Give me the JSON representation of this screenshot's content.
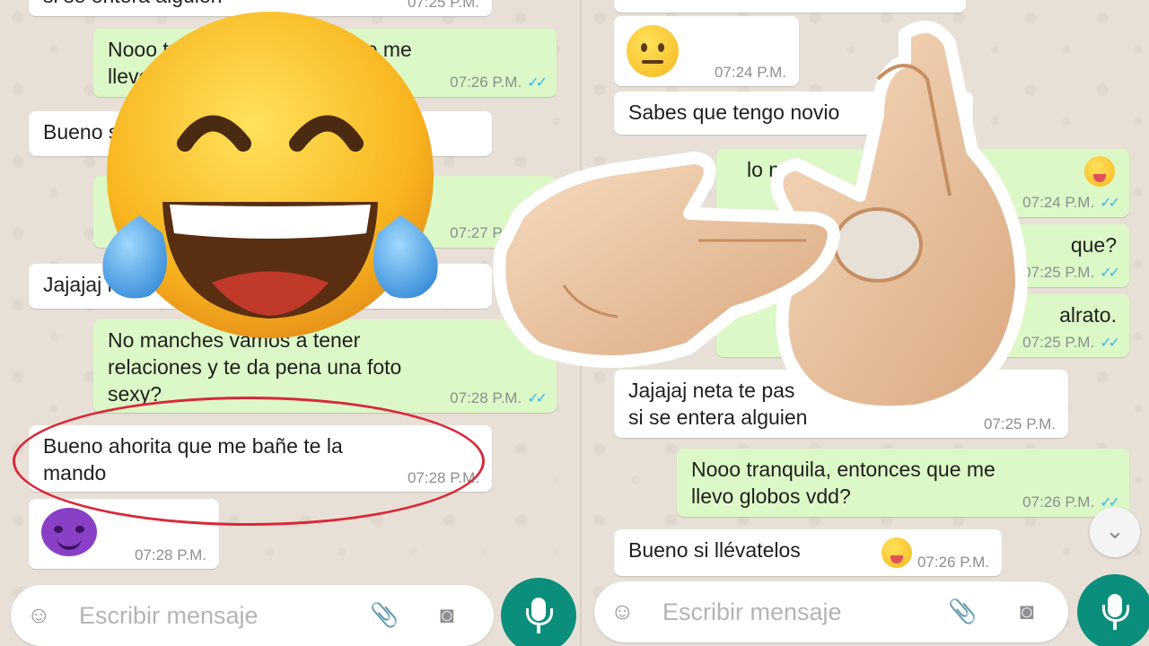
{
  "left": {
    "messages": [
      {
        "dir": "in",
        "text": "si se entera alguien",
        "time": "07:25 P.M."
      },
      {
        "dir": "out",
        "text": "Nooo tranquila, entonces que me\nllevo globos vdd?",
        "time": "07:26 P.M."
      },
      {
        "dir": "in",
        "text": "Bueno si llévatelos",
        "time": ""
      },
      {
        "dir": "out",
        "text": "",
        "time": "07:27 P.M."
      },
      {
        "dir": "in",
        "text": "Jajajaj neta",
        "time": ""
      },
      {
        "dir": "out",
        "text": "No manches vamos a tener\nrelaciones y te da pena una foto\nsexy?",
        "time": "07:28 P.M."
      },
      {
        "dir": "in",
        "text": "Bueno ahorita que me bañe te la\nmando",
        "time": "07:28 P.M."
      },
      {
        "dir": "in",
        "emoji": "devil",
        "time": "07:28 P.M."
      }
    ],
    "input": {
      "placeholder": "Escribir mensaje"
    }
  },
  "right": {
    "messages": [
      {
        "dir": "in",
        "emoji": "neutral",
        "time": "07:24 P.M."
      },
      {
        "dir": "in",
        "text": "Sabes que tengo novio",
        "time": ""
      },
      {
        "dir": "out",
        "text": "lo mi                     erar",
        "time": "07:24 P.M."
      },
      {
        "dir": "out",
        "text": "que?",
        "time": "07:25 P.M."
      },
      {
        "dir": "out",
        "text": "alrato.",
        "time": "07:25 P.M."
      },
      {
        "dir": "in",
        "text": "Jajajaj neta te pas              e ti\nsi se entera alguien",
        "time": "07:25 P.M."
      },
      {
        "dir": "out",
        "text": "Nooo tranquila, entonces que me\nllevo globos vdd?",
        "time": "07:26 P.M."
      },
      {
        "dir": "in",
        "text": "Bueno si llévatelos",
        "time": "07:26 P.M."
      }
    ],
    "input": {
      "placeholder": "Escribir mensaje"
    }
  },
  "icons": {
    "emoji": "smiley-icon",
    "attach": "paperclip-icon",
    "camera": "camera-icon",
    "mic": "microphone-icon",
    "scroll": "chevron-double-down-icon"
  },
  "colors": {
    "incoming": "#ffffff",
    "outgoing": "#dcf8c6",
    "accent": "#0b8f7c",
    "read_ticks": "#34b7f1",
    "highlight_circle": "#d9283a"
  }
}
